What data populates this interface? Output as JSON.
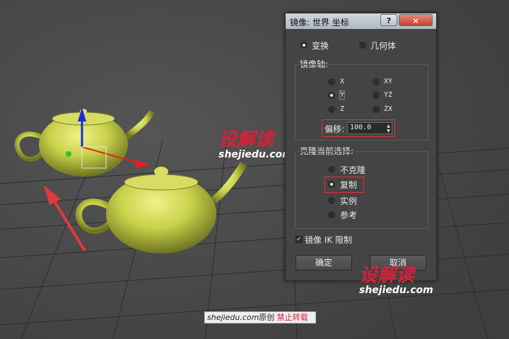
{
  "dialog": {
    "title": "镜像: 世界 坐标",
    "help_label": "?",
    "close_label": "×",
    "mode_options": [
      {
        "label": "变换",
        "selected": true
      },
      {
        "label": "几何体",
        "selected": false
      }
    ],
    "mirror_axis": {
      "heading": "镜像轴:",
      "axes": [
        {
          "label": "X",
          "selected": false
        },
        {
          "label": "Y",
          "selected": true
        },
        {
          "label": "Z",
          "selected": false
        },
        {
          "label": "XY",
          "selected": false
        },
        {
          "label": "YZ",
          "selected": false
        },
        {
          "label": "ZX",
          "selected": false
        }
      ],
      "offset_label": "偏移:",
      "offset_value": "100.0"
    },
    "clone": {
      "heading": "克隆当前选择:",
      "options": [
        {
          "label": "不克隆",
          "selected": false
        },
        {
          "label": "复制",
          "selected": true
        },
        {
          "label": "实例",
          "selected": false
        },
        {
          "label": "参考",
          "selected": false
        }
      ]
    },
    "mirror_ik_label": "镜像 IK 限制",
    "mirror_ik_checked": true,
    "ok_label": "确定",
    "cancel_label": "取消"
  },
  "watermarks": [
    {
      "logo": "设解读",
      "url": "shejiedu.com"
    },
    {
      "logo": "设解读",
      "url": "shejiedu.com"
    }
  ],
  "banner": {
    "site": "shejiedu.com",
    "middle": "原创",
    "notice": "禁止转载"
  },
  "colors": {
    "teapot": "#c9d24a",
    "highlight_red": "#e0303b",
    "arrow_red": "#e23a3a",
    "dialog_bg": "#444444"
  }
}
